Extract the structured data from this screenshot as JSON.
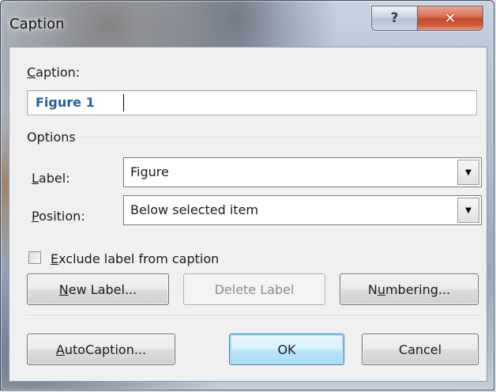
{
  "window": {
    "title": "Caption",
    "help_glyph": "?",
    "close_glyph": "✕",
    "close_color": "#c7482e"
  },
  "caption": {
    "label_prefix": "C",
    "label_rest": "aption:",
    "value": "Figure 1"
  },
  "options": {
    "group_label": "Options",
    "label_field": {
      "label_prefix": "L",
      "label_rest": "abel:",
      "value": "Figure"
    },
    "position_field": {
      "label_prefix": "P",
      "label_rest": "osition:",
      "value": "Below selected item"
    }
  },
  "exclude_checkbox": {
    "label_prefix": "E",
    "label_rest": "xclude label from caption",
    "checked": false
  },
  "buttons": {
    "new_label": {
      "u": "N",
      "rest": "ew Label..."
    },
    "delete_label": {
      "text": "Delete Label"
    },
    "numbering": {
      "pre": "N",
      "u": "u",
      "rest": "mbering..."
    },
    "autocaption": {
      "u": "A",
      "rest": "utoCaption..."
    },
    "ok": {
      "text": "OK"
    },
    "cancel": {
      "text": "Cancel"
    }
  },
  "icons": {
    "dropdown_arrow": "▼"
  }
}
